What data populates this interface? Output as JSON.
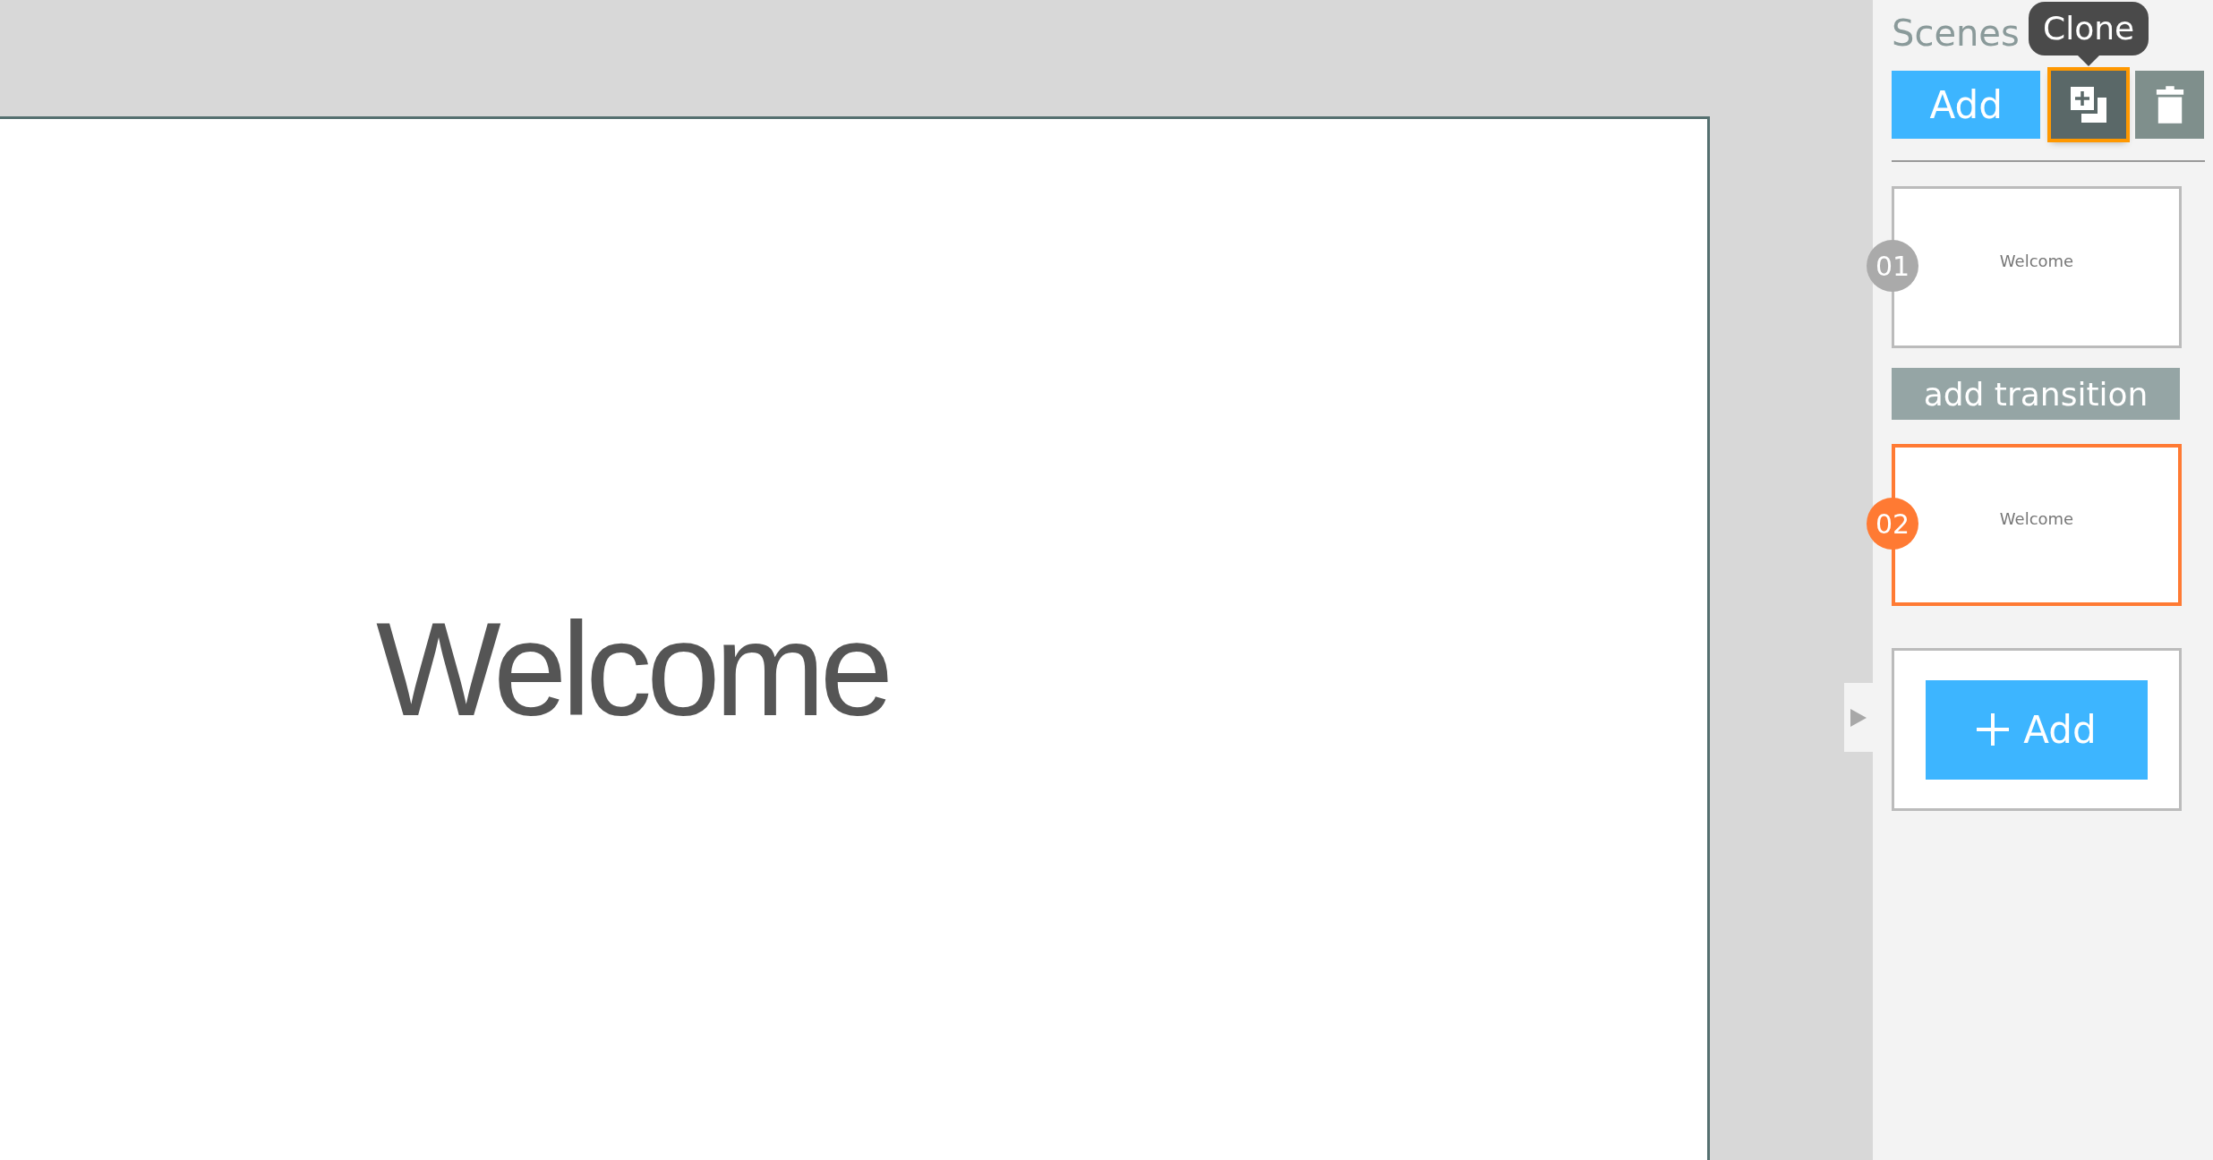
{
  "canvas": {
    "slide_text": "Welcome"
  },
  "panel": {
    "title": "Scenes",
    "tooltip": "Clone",
    "add_button": "Add",
    "scenes": [
      {
        "number": "01",
        "text": "Welcome",
        "selected": false,
        "transition": "add transition"
      },
      {
        "number": "02",
        "text": "Welcome",
        "selected": true
      }
    ],
    "add_scene": "Add"
  }
}
